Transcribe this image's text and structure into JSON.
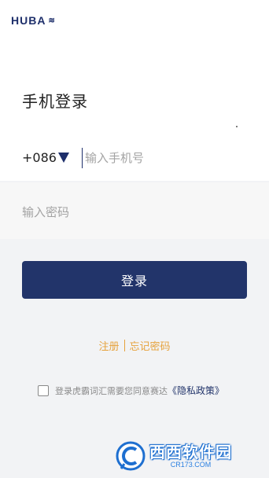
{
  "app": {
    "logo_text": "HUBA"
  },
  "page": {
    "title": "手机登录"
  },
  "phone": {
    "country_code": "+086",
    "placeholder": "输入手机号"
  },
  "password": {
    "placeholder": "输入密码"
  },
  "actions": {
    "login_label": "登录",
    "register_label": "注册",
    "forgot_label": "忘记密码"
  },
  "agreement": {
    "text": "登录虎霸词汇需要您同意赛达",
    "policy_link": "《隐私政策》"
  },
  "watermark": {
    "main": "西西软件园",
    "sub": "CR173.COM"
  },
  "colors": {
    "brand": "#22346a",
    "link": "#e6a23c",
    "background": "#f2f3f5"
  },
  "icons": {
    "country_dropdown": "triangle-down-icon",
    "agree_checkbox": "checkbox-icon"
  }
}
